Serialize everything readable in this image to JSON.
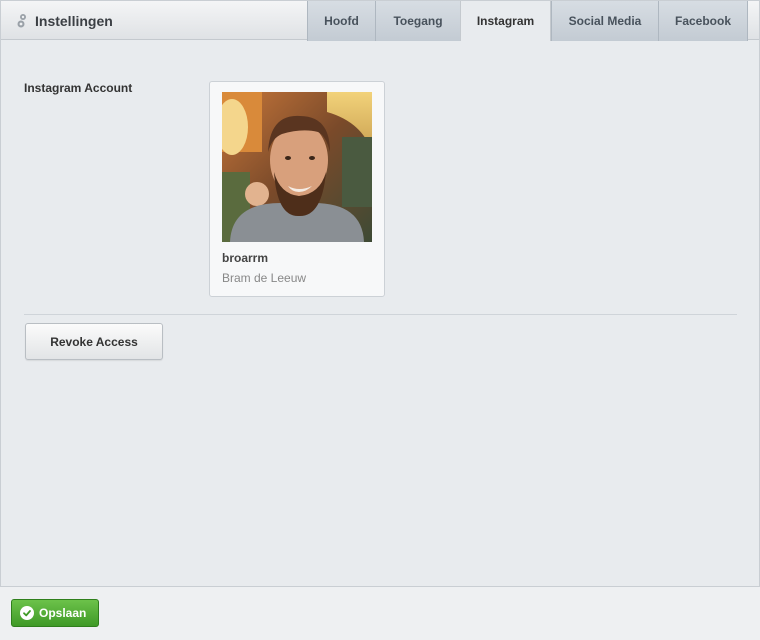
{
  "header": {
    "title": "Instellingen",
    "icon": "settings-icon"
  },
  "tabs": [
    {
      "label": "Hoofd",
      "active": false
    },
    {
      "label": "Toegang",
      "active": false
    },
    {
      "label": "Instagram",
      "active": true
    },
    {
      "label": "Social Media",
      "active": false
    },
    {
      "label": "Facebook",
      "active": false
    }
  ],
  "instagram": {
    "field_label": "Instagram Account",
    "username": "broarrm",
    "full_name": "Bram de Leeuw",
    "revoke_label": "Revoke Access"
  },
  "footer": {
    "save_label": "Opslaan",
    "save_icon": "check-circle-icon"
  },
  "colors": {
    "save_green": "#4cae33",
    "panel_bg": "#e8ebee",
    "tab_bg": "#c9d0d7"
  }
}
